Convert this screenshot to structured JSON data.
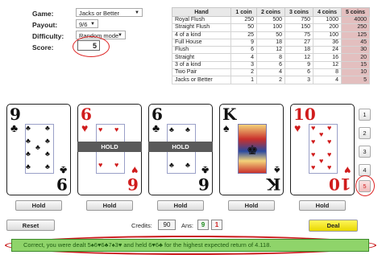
{
  "settings": {
    "game_label": "Game:",
    "game_value": "Jacks or Better",
    "payout_label": "Payout:",
    "payout_value": "9/6",
    "difficulty_label": "Difficulty:",
    "difficulty_value": "Random mode",
    "score_label": "Score:",
    "score_value": "5"
  },
  "paytable": {
    "headers": [
      "Hand",
      "1 coin",
      "2 coins",
      "3 coins",
      "4 coins",
      "5 coins"
    ],
    "rows": [
      [
        "Royal Flush",
        "250",
        "500",
        "750",
        "1000",
        "4000"
      ],
      [
        "Straight Flush",
        "50",
        "100",
        "150",
        "200",
        "250"
      ],
      [
        "4 of a kind",
        "25",
        "50",
        "75",
        "100",
        "125"
      ],
      [
        "Full House",
        "9",
        "18",
        "27",
        "36",
        "45"
      ],
      [
        "Flush",
        "6",
        "12",
        "18",
        "24",
        "30"
      ],
      [
        "Straight",
        "4",
        "8",
        "12",
        "16",
        "20"
      ],
      [
        "3 of a kind",
        "3",
        "6",
        "9",
        "12",
        "15"
      ],
      [
        "Two Pair",
        "2",
        "4",
        "6",
        "8",
        "10"
      ],
      [
        "Jacks or Better",
        "1",
        "2",
        "3",
        "4",
        "5"
      ]
    ]
  },
  "cards": [
    {
      "rank": "9",
      "suit": "♣",
      "color": "#111111",
      "held": false
    },
    {
      "rank": "6",
      "suit": "♥",
      "color": "#d01c1c",
      "held": true
    },
    {
      "rank": "6",
      "suit": "♣",
      "color": "#111111",
      "held": true
    },
    {
      "rank": "K",
      "suit": "♠",
      "color": "#111111",
      "held": false
    },
    {
      "rank": "10",
      "suit": "♥",
      "color": "#d01c1c",
      "held": false
    }
  ],
  "hold_overlay_label": "HOLD",
  "hold_button_label": "Hold",
  "coin_buttons": [
    "1",
    "2",
    "3",
    "4",
    "5"
  ],
  "controls": {
    "reset_label": "Reset",
    "credits_label": "Credits:",
    "credits_value": "90",
    "ans_label": "Ans:",
    "ans_correct": "9",
    "ans_wrong": "1",
    "deal_label": "Deal"
  },
  "message": "Correct, you were dealt 5♠6♥6♣7♠3♥ and held 6♥6♣ for the highest expected return of 4.118.",
  "colors": {
    "message_bg": "#8fd46a",
    "message_border": "#3c8a2a",
    "deal_bg": "#f2e400",
    "accent_red": "#d22222"
  }
}
